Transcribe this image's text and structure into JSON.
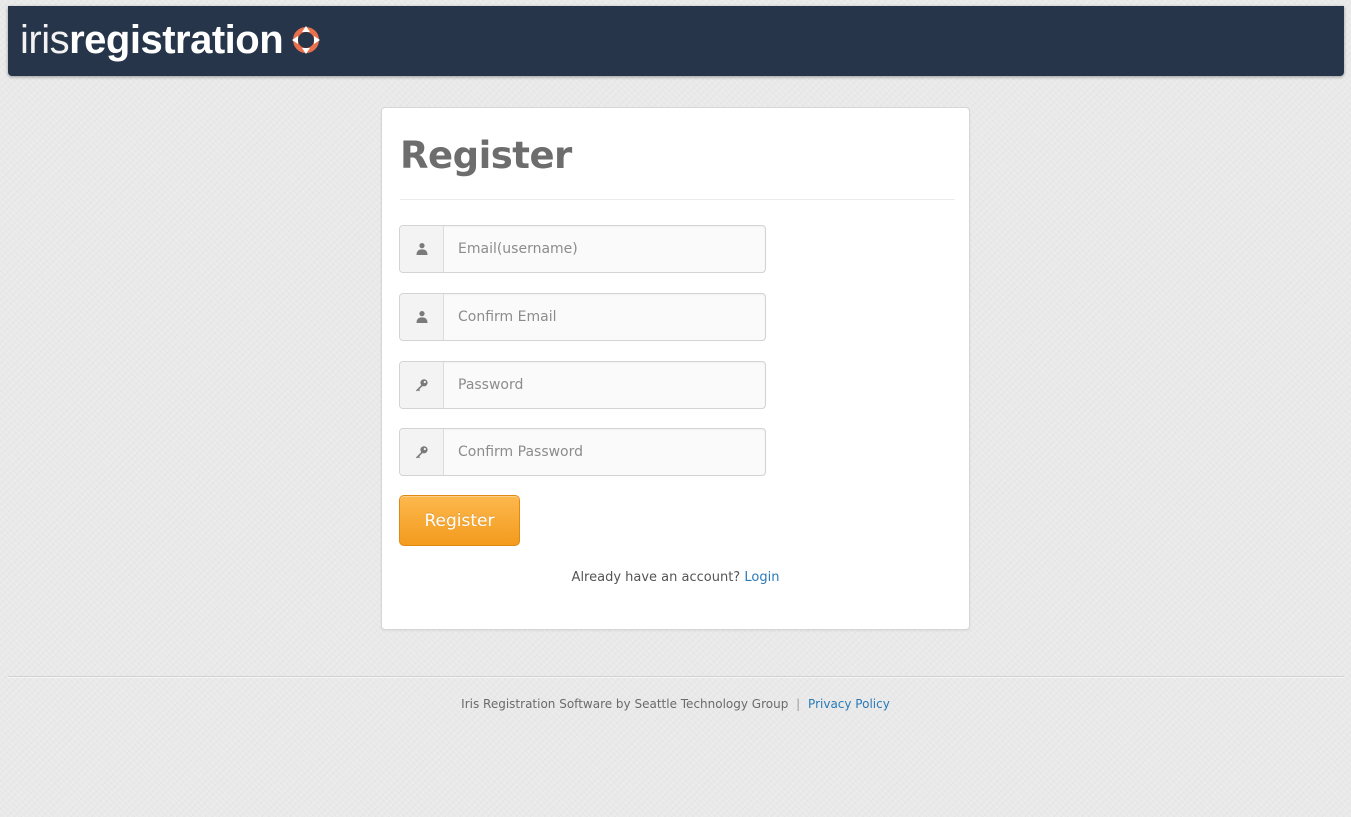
{
  "header": {
    "brand_light": "iris",
    "brand_bold": "registration",
    "logo_icon": "iris-logo-icon",
    "background_color": "#263549",
    "accent_color": "#e8704c"
  },
  "form": {
    "title": "Register",
    "fields": [
      {
        "placeholder": "Email(username)",
        "value": "",
        "icon": "user-icon"
      },
      {
        "placeholder": "Confirm Email",
        "value": "",
        "icon": "user-icon"
      },
      {
        "placeholder": "Password",
        "value": "",
        "icon": "key-icon"
      },
      {
        "placeholder": "Confirm Password",
        "value": "",
        "icon": "key-icon"
      }
    ],
    "submit_label": "Register",
    "submit_color": "#f7a42c",
    "login_prompt": "Already have an account?",
    "login_link": "Login"
  },
  "footer": {
    "credit": "Iris Registration Software by Seattle Technology Group",
    "separator": "|",
    "privacy_link": "Privacy Policy",
    "link_color": "#2a7ab8"
  }
}
